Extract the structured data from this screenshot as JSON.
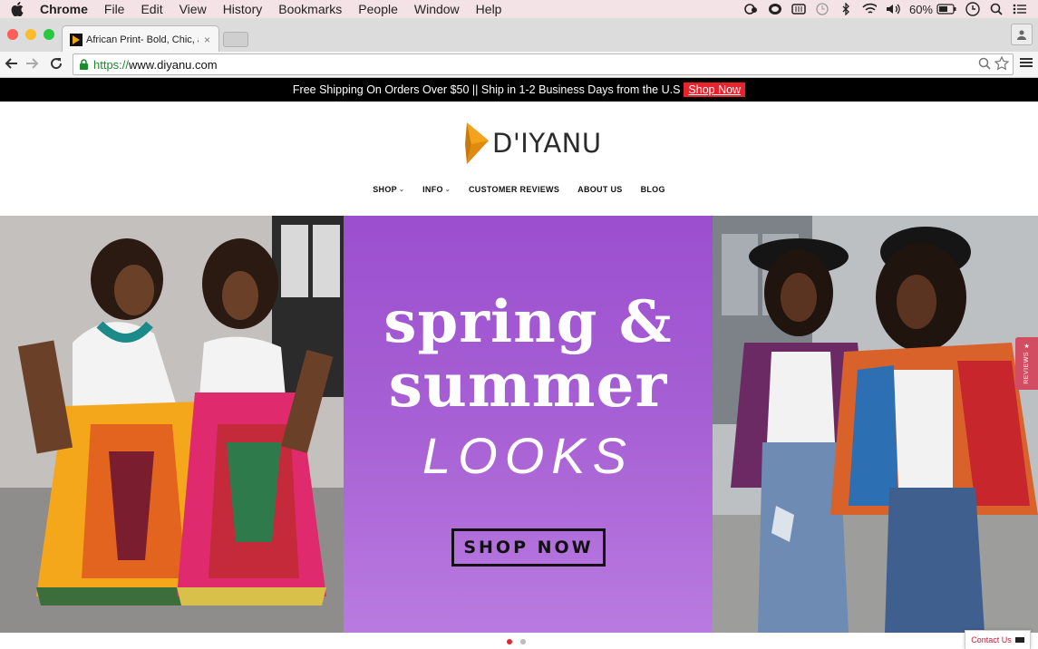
{
  "menubar": {
    "items": [
      "Chrome",
      "File",
      "Edit",
      "View",
      "History",
      "Bookmarks",
      "People",
      "Window",
      "Help"
    ],
    "battery": "60%",
    "icons": [
      "apple-icon",
      "creative-cloud-icon",
      "sync-icon",
      "display-icon",
      "time-machine-icon",
      "bluetooth-icon",
      "wifi-icon",
      "volume-icon",
      "battery-icon",
      "clock-icon",
      "spotlight-icon",
      "notification-center-icon"
    ]
  },
  "tab": {
    "title": "African Print- Bold, Chic, ar",
    "close": "×"
  },
  "address": {
    "scheme": "https://",
    "host": "www.diyanu.com"
  },
  "promo": {
    "text": "Free Shipping On Orders Over $50 || Ship in 1-2 Business Days from the U.S",
    "link": "Shop Now"
  },
  "logo": {
    "text": "D'IYANU"
  },
  "nav": {
    "items": [
      {
        "label": "SHOP",
        "caret": "⌄"
      },
      {
        "label": "INFO",
        "caret": "⌄"
      },
      {
        "label": "CUSTOMER REVIEWS"
      },
      {
        "label": "ABOUT US"
      },
      {
        "label": "BLOG"
      }
    ]
  },
  "hero": {
    "line1": "spring &",
    "line2": "summer",
    "line3": "LOOKS",
    "button": "SHOP NOW",
    "slides": 2,
    "active_slide": 1
  },
  "review_tab": {
    "star": "★",
    "label": "REVIEWS"
  },
  "contact": {
    "label": "Contact Us"
  },
  "colors": {
    "promo_link": "#e8232d",
    "hero_purple": "#a760d4",
    "review_tab": "#d24d61",
    "dot_active": "#e8232d",
    "dot_inactive": "#bbbbbb",
    "logo_orange": "#f2a31b"
  }
}
